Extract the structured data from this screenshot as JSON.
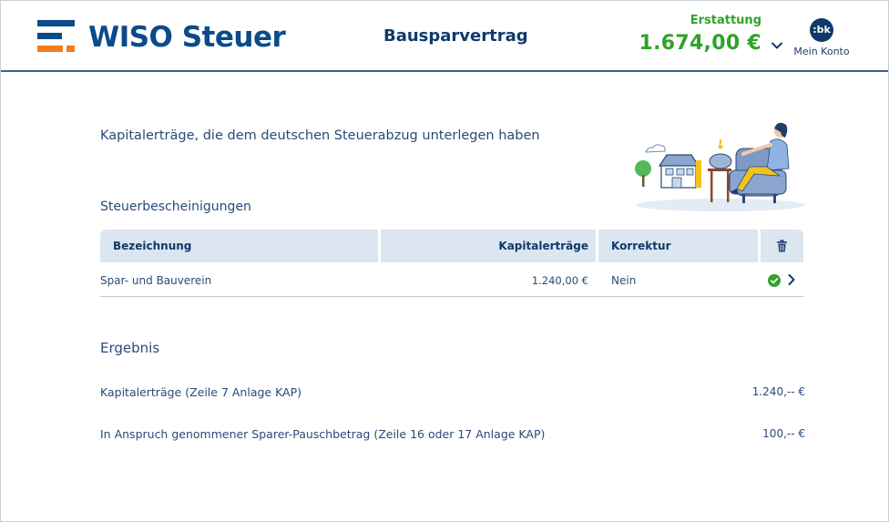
{
  "header": {
    "logo_text": "WISO Steuer",
    "title": "Bausparvertrag",
    "refund_label": "Erstattung",
    "refund_amount": "1.674,00 €",
    "avatar_initials": ":bk",
    "account_label": "Mein Konto"
  },
  "colors": {
    "brand_blue": "#0b4a8b",
    "accent_orange": "#f07c1e",
    "success_green": "#2fa32a",
    "table_header_bg": "#dbe6f1"
  },
  "icons": {
    "logo": "wiso-logo-bars",
    "dropdown": "chevron-down-icon",
    "delete": "trash-icon",
    "status": "check-circle-icon",
    "open": "chevron-right-icon"
  },
  "main": {
    "heading": "Kapitalerträge, die dem deutschen Steuerabzug unterlegen haben",
    "certificates_heading": "Steuerbescheinigungen",
    "table": {
      "columns": [
        "Bezeichnung",
        "Kapitalerträge",
        "Korrektur"
      ],
      "rows": [
        {
          "name": "Spar- und Bauverein",
          "amount": "1.240,00 €",
          "correction": "Nein"
        }
      ]
    },
    "result": {
      "heading": "Ergebnis",
      "rows": [
        {
          "label": "Kapitalerträge (Zeile 7 Anlage KAP)",
          "value": "1.240,-- €"
        },
        {
          "label": "In Anspruch genommener Sparer-Pauschbetrag (Zeile 16 oder 17 Anlage KAP)",
          "value": "100,-- €"
        }
      ]
    }
  }
}
